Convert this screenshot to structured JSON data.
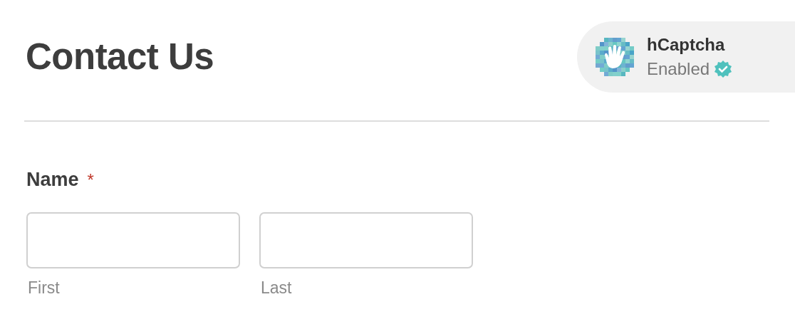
{
  "form": {
    "title": "Contact Us"
  },
  "captcha_badge": {
    "name": "hCaptcha",
    "status": "Enabled",
    "enabled": true
  },
  "field": {
    "label": "Name",
    "required": true,
    "required_mark": "*",
    "inputs": [
      {
        "sublabel": "First"
      },
      {
        "sublabel": "Last"
      }
    ]
  }
}
